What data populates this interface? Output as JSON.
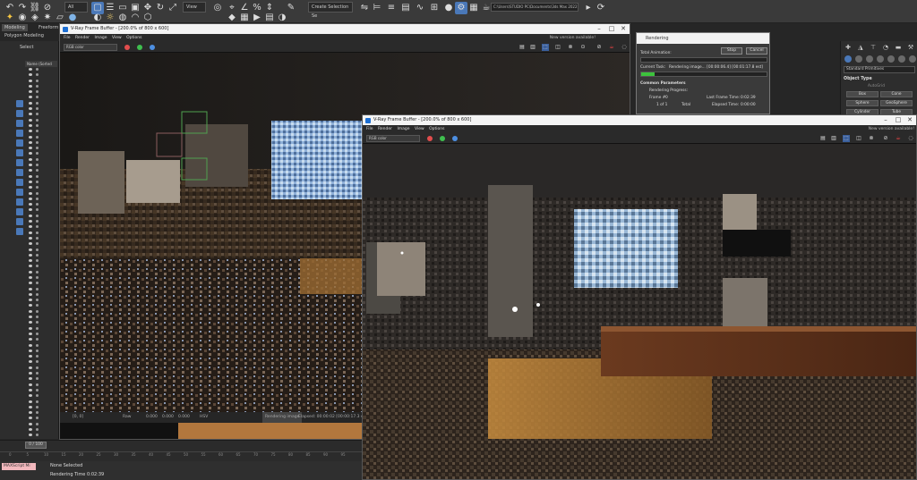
{
  "toolbar": {
    "filter_value": "All",
    "view_value": "View",
    "selection_set_placeholder": "Create Selection Se",
    "project_path": "C:\\Users\\STUDIO PC\\Documents\\3ds Max 2022",
    "icons": [
      "undo-icon",
      "redo-icon",
      "link-icon",
      "unlink-icon",
      "bind-icon",
      "select-icon",
      "select-region-icon",
      "select-by-name-icon",
      "move-icon",
      "rotate-icon",
      "scale-icon",
      "snap-icon",
      "angle-snap-icon",
      "percent-snap-icon",
      "mirror-icon",
      "align-icon",
      "render-setup-icon",
      "render-frame-icon",
      "render-icon",
      "teapot-icon"
    ]
  },
  "ribbon": {
    "tabs": [
      "Modeling",
      "Freeform"
    ],
    "subtab": "Polygon Modeling"
  },
  "scene_explorer": {
    "label": "Select",
    "column_header": "Name (Sorted",
    "row_count": 68
  },
  "vfb_back": {
    "title": "V-Ray Frame Buffer - [200.0% of 800 x 600]",
    "menu": [
      "File",
      "Render",
      "Image",
      "View",
      "Options"
    ],
    "new_version": "New version available!",
    "channel": "RGB color",
    "status_left": "[0, 0]",
    "status_mid": "Raw",
    "status_values": [
      "0.000",
      "0.000",
      "0.000"
    ],
    "status_hsv": "HSV",
    "status_pass": "Rendering image",
    "status_right": "Elapsed: 00:00:02 [00:00:17.3 est]"
  },
  "vfb_front": {
    "title": "V-Ray Frame Buffer - [200.0% of 800 x 600]",
    "menu": [
      "File",
      "Render",
      "Image",
      "View",
      "Options"
    ],
    "new_version": "New version available!",
    "channel": "RGB color"
  },
  "render_dialog": {
    "title": "Rendering",
    "stop_label": "Stop",
    "cancel_label": "Cancel",
    "total_animation_label": "Total Animation:",
    "current_task_label": "Current Task:",
    "current_task_value": "Rendering image... [00:00:06.4] [00:01:17.8 est]",
    "section_title": "Common Parameters",
    "rendering_progress_label": "Rendering Progress:",
    "frame_label": "Frame #",
    "frame_value": "0",
    "last_frame_time_label": "Last Frame Time:",
    "last_frame_time_value": "0:02:39",
    "of_label": "1 of 1",
    "total_label": "Total",
    "elapsed_label": "Elapsed Time:",
    "elapsed_value": "0:00:00",
    "total_progress": 0,
    "task_progress": 0.11
  },
  "command_panel": {
    "dropdown": "Standard Primitives",
    "rollout_title": "Object Type",
    "autogrid_label": "AutoGrid",
    "buttons": [
      "Box",
      "Cone",
      "Sphere",
      "GeoSphere",
      "Cylinder",
      "Tube"
    ]
  },
  "timeline": {
    "slider_label": "0 / 100",
    "ticks": [
      "0",
      "5",
      "10",
      "15",
      "20",
      "25",
      "30",
      "35",
      "40",
      "45",
      "50",
      "55",
      "60",
      "65",
      "70",
      "75",
      "80",
      "85",
      "90",
      "95"
    ]
  },
  "status": {
    "maxscript_label": "MAXScript Mi",
    "selection": "None Selected",
    "rendering_time": "Rendering Time 0:02:39"
  },
  "colors": {
    "accent_blue": "#4a78b8",
    "progress_green": "#3cc33c",
    "maxscript_pink": "#f2b8bd"
  }
}
